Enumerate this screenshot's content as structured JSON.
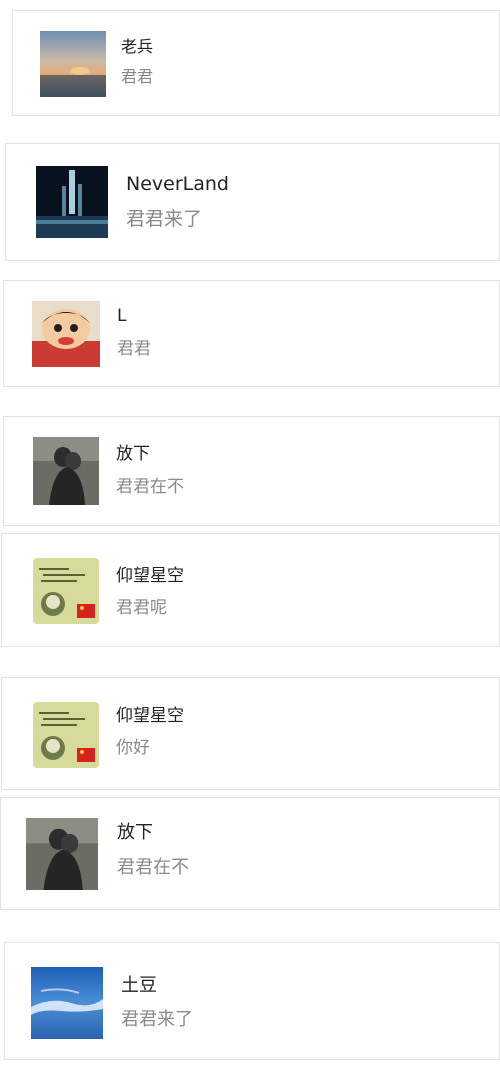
{
  "messages": [
    {
      "name": "老兵",
      "text": "君君",
      "avatar_icon": "sunset-sky-avatar-icon"
    },
    {
      "name": "NeverLand",
      "text": "君君来了",
      "avatar_icon": "night-fountain-avatar-icon"
    },
    {
      "name": "L",
      "text": "君君",
      "avatar_icon": "cartoon-boy-avatar-icon"
    },
    {
      "name": "放下",
      "text": "君君在不",
      "avatar_icon": "couple-photo-avatar-icon"
    },
    {
      "name": "仰望星空",
      "text": "君君呢",
      "avatar_icon": "meme-flag-avatar-icon"
    },
    {
      "name": "仰望星空",
      "text": "你好",
      "avatar_icon": "meme-flag-avatar-icon"
    },
    {
      "name": "放下",
      "text": "君君在不",
      "avatar_icon": "couple-photo-avatar-icon"
    },
    {
      "name": "土豆",
      "text": "君君来了",
      "avatar_icon": "blue-sky-avatar-icon"
    }
  ]
}
